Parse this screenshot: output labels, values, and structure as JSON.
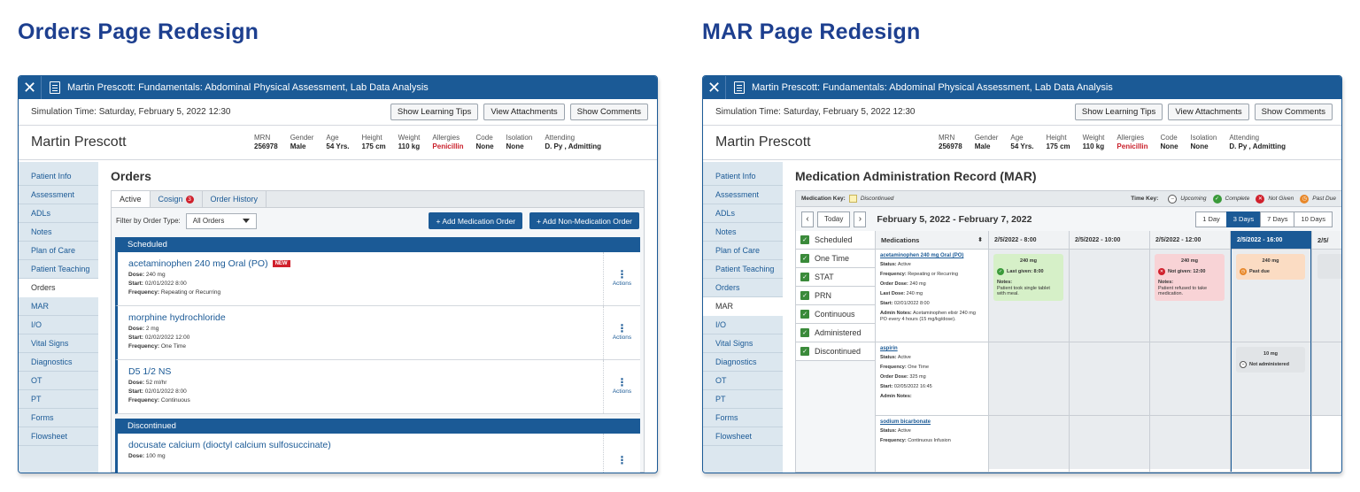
{
  "headings": {
    "orders": "Orders Page Redesign",
    "mar": "MAR Page Redesign"
  },
  "window": {
    "title": "Martin Prescott: Fundamentals: Abdominal Physical Assessment, Lab Data Analysis",
    "simulation_time": "Simulation Time: Saturday, February 5, 2022 12:30",
    "buttons": {
      "tips": "Show Learning Tips",
      "attachments": "View Attachments",
      "comments": "Show Comments"
    },
    "close_glyph": "✕"
  },
  "patient": {
    "name": "Martin Prescott",
    "fields": [
      {
        "label": "MRN",
        "value": "256978"
      },
      {
        "label": "Gender",
        "value": "Male"
      },
      {
        "label": "Age",
        "value": "54 Yrs."
      },
      {
        "label": "Height",
        "value": "175 cm"
      },
      {
        "label": "Weight",
        "value": "110 kg"
      },
      {
        "label": "Allergies",
        "value": "Penicillin"
      },
      {
        "label": "Code",
        "value": "None"
      },
      {
        "label": "Isolation",
        "value": "None"
      },
      {
        "label": "Attending",
        "value": "D. Py , Admitting"
      }
    ]
  },
  "sidebar": {
    "items": [
      "Patient Info",
      "Assessment",
      "ADLs",
      "Notes",
      "Plan of Care",
      "Patient Teaching",
      "Orders",
      "MAR",
      "I/O",
      "Vital Signs",
      "Diagnostics",
      "OT",
      "PT",
      "Forms",
      "Flowsheet"
    ]
  },
  "orders": {
    "title": "Orders",
    "tabs": {
      "active": "Active",
      "cosign": "Cosign",
      "cosign_count": "3",
      "history": "Order History"
    },
    "filter_label": "Filter by Order Type:",
    "filter_value": "All Orders",
    "add_med": "+ Add Medication Order",
    "add_nonmed": "+ Add Non-Medication Order",
    "scheduled_label": "Scheduled",
    "discontinued_label": "Discontinued",
    "actions_label": "Actions",
    "new_badge": "NEW",
    "items": [
      {
        "name": "acetaminophen 240 mg Oral (PO)",
        "dose": "240 mg",
        "start": "02/01/2022 8:00",
        "frequency": "Repeating or Recurring"
      },
      {
        "name": "morphine hydrochloride",
        "dose": "2 mg",
        "start": "02/02/2022 12:00",
        "frequency": "One Time"
      },
      {
        "name": "D5 1/2 NS",
        "dose": "52 ml/hr",
        "start": "02/01/2022 8:00",
        "frequency": "Continuous"
      }
    ],
    "discontinued": [
      {
        "name": "docusate calcium (dioctyl calcium sulfosuccinate)",
        "dose": "100 mg"
      }
    ],
    "field_labels": {
      "dose": "Dose:",
      "start": "Start:",
      "frequency": "Frequency:"
    }
  },
  "mar": {
    "title": "Medication Administration Record (MAR)",
    "med_key_label": "Medication Key:",
    "med_key_value": "Discontinued",
    "time_key_label": "Time Key:",
    "time_keys": {
      "upcoming": "Upcoming",
      "complete": "Complete",
      "not_given": "Not Given",
      "past_due": "Past Due"
    },
    "today": "Today",
    "date_range": "February 5, 2022 - February 7, 2022",
    "ranges": [
      "1 Day",
      "3 Days",
      "7 Days",
      "10 Days"
    ],
    "filters": [
      "Scheduled",
      "One Time",
      "STAT",
      "PRN",
      "Continuous",
      "Administered",
      "Discontinued"
    ],
    "med_column": "Medications",
    "time_columns": [
      "2/5/2022 - 8:00",
      "2/5/2022 - 10:00",
      "2/5/2022 - 12:00",
      "2/5/2022 - 16:00",
      "2/5/"
    ],
    "meds": [
      {
        "name": "acetaminophen 240 mg Oral (PO)",
        "status": "Active",
        "frequency": "Repeating or Recurring",
        "order_dose": "240 mg",
        "last_dose": "240 mg",
        "start": "02/01/2022 8:00",
        "admin_notes": "Acetaminophen elixir 240 mg PO every 4 hours (15 mg/kg/dose)."
      },
      {
        "name": "aspirin",
        "status": "Active",
        "frequency": "One Time",
        "order_dose": "325 mg",
        "start": "02/05/2022 16:45",
        "admin_notes": ""
      },
      {
        "name": "sodium bicarbonate",
        "status": "Active",
        "frequency": "Continuous Infusion"
      }
    ],
    "field_labels": {
      "status": "Status:",
      "frequency": "Frequency:",
      "order_dose": "Order Dose:",
      "last_dose": "Last Dose:",
      "start": "Start:",
      "admin_notes": "Admin Notes:"
    },
    "cards": {
      "c1": {
        "dose": "240 mg",
        "status": "Last given: 8:00",
        "notes_label": "Notes:",
        "notes": "Patient took single tablet with meal."
      },
      "c2": {
        "dose": "240 mg",
        "status": "Not given: 12:00",
        "notes_label": "Notes:",
        "notes": "Patient refused to take medication."
      },
      "c3": {
        "dose": "240 mg",
        "status": "Past due"
      },
      "c4": {
        "dose": "10 mg",
        "status": "Not administered"
      }
    },
    "colors": {
      "complete": "#3a9a3a",
      "not_given": "#d0202c",
      "past_due": "#e8882a",
      "brand": "#1b5a96"
    }
  }
}
